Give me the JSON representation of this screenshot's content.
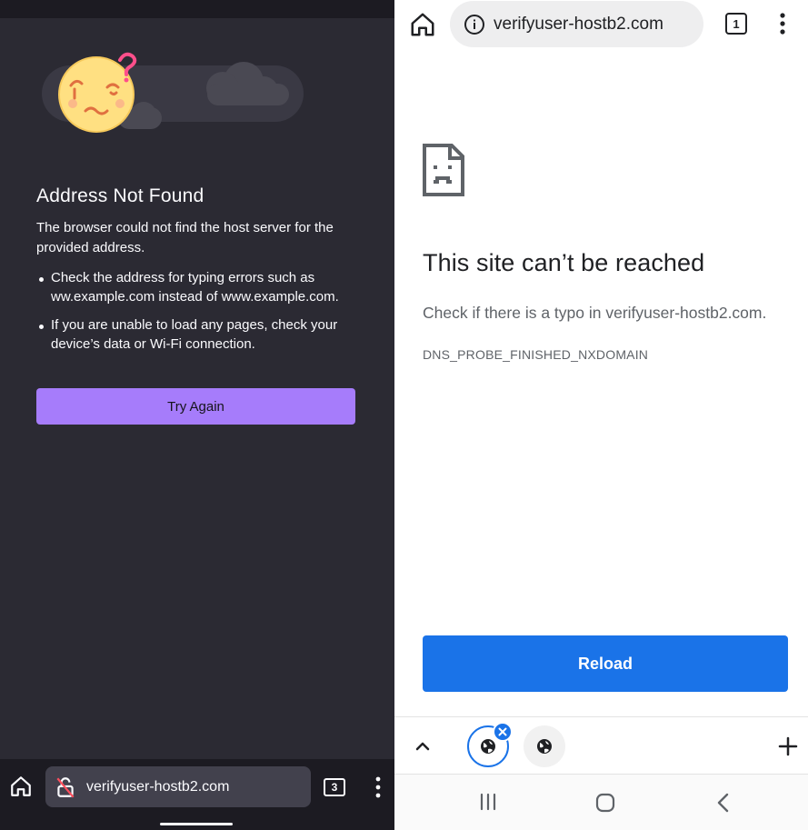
{
  "firefox": {
    "title": "Address Not Found",
    "description": "The browser could not find the host server for the provided address.",
    "tips": [
      "Check the address for typing errors such as ww.example.com instead of www.example.com.",
      "If you are unable to load any pages, check your device’s data or Wi-Fi connection."
    ],
    "try_again_label": "Try Again",
    "url": "verifyuser-hostb2.com",
    "tab_count": "3",
    "accent_color": "#a67cfb",
    "icons": [
      "home-icon",
      "broken-lock-icon",
      "tabs-counter",
      "more-vert-icon",
      "confused-face-illustration",
      "cloud-icon"
    ]
  },
  "chrome": {
    "url": "verifyuser-hostb2.com",
    "tab_count": "1",
    "title": "This site can’t be reached",
    "description": "Check if there is a typo in verifyuser-hostb2.com.",
    "error_code": "DNS_PROBE_FINISHED_NXDOMAIN",
    "reload_label": "Reload",
    "accent_color": "#1a73e8",
    "icons": [
      "home-icon",
      "info-icon",
      "more-vert-icon",
      "sad-page-icon",
      "chevron-up-icon",
      "globe-icon",
      "close-icon",
      "plus-icon"
    ]
  },
  "system_nav": {
    "icons": [
      "recents-icon",
      "home-icon",
      "back-icon"
    ]
  }
}
